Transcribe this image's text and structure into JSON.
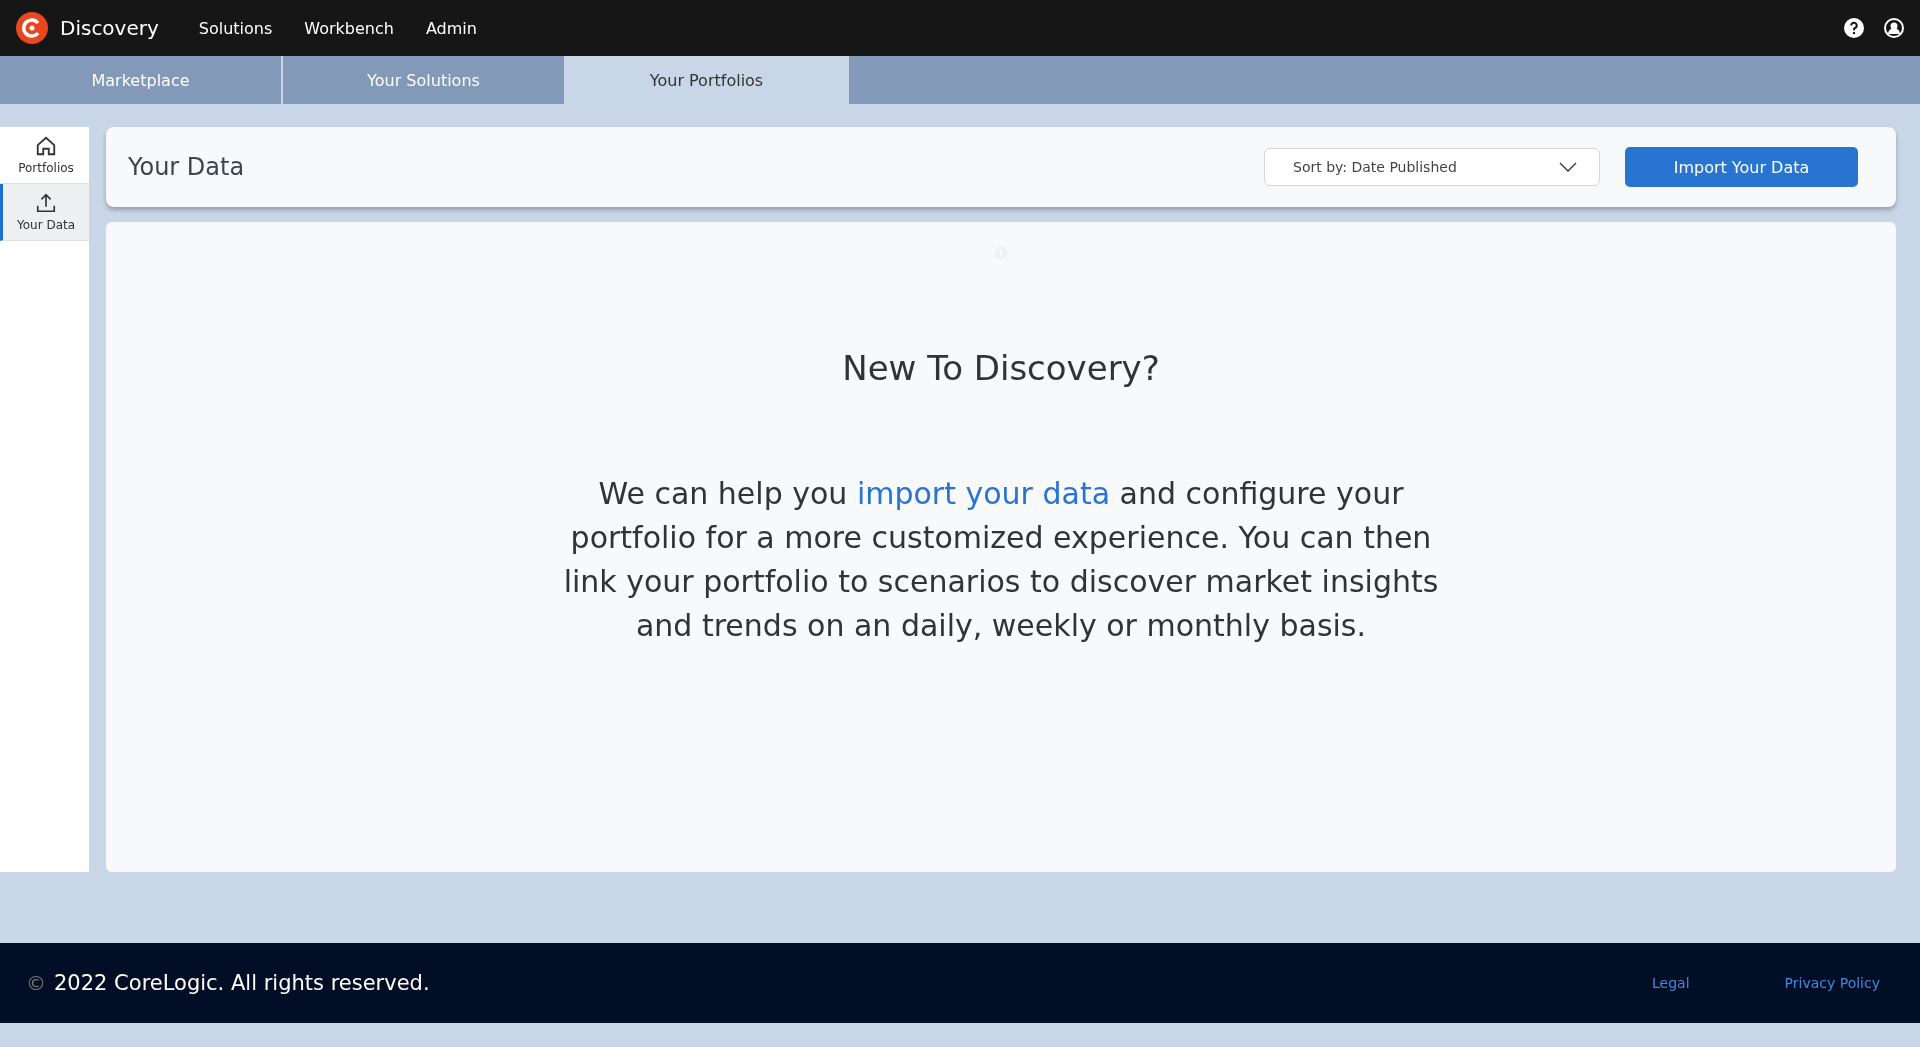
{
  "header": {
    "app_name": "Discovery",
    "nav": [
      "Solutions",
      "Workbench",
      "Admin"
    ]
  },
  "tabs": [
    {
      "label": "Marketplace",
      "selected": false
    },
    {
      "label": "Your Solutions",
      "selected": false
    },
    {
      "label": "Your Portfolios",
      "selected": true
    }
  ],
  "sidebar": {
    "items": [
      {
        "label": "Portfolios",
        "selected": false
      },
      {
        "label": "Your Data",
        "selected": true
      }
    ]
  },
  "toolbar": {
    "title": "Your Data",
    "sort": "Sort by: Date Published",
    "button": "Import Your Data"
  },
  "empty_state": {
    "heading": "New To Discovery?",
    "text_before": "We can help you ",
    "link": "import your data",
    "text_after": " and configure your portfolio for a more customized experience. You can then link your portfolio to scenarios to discover market insights and trends on an daily, weekly or monthly basis."
  },
  "footer": {
    "symbol": "©",
    "copyright": "2022 CoreLogic. All rights reserved.",
    "links": [
      "Legal",
      "Privacy Policy"
    ]
  }
}
